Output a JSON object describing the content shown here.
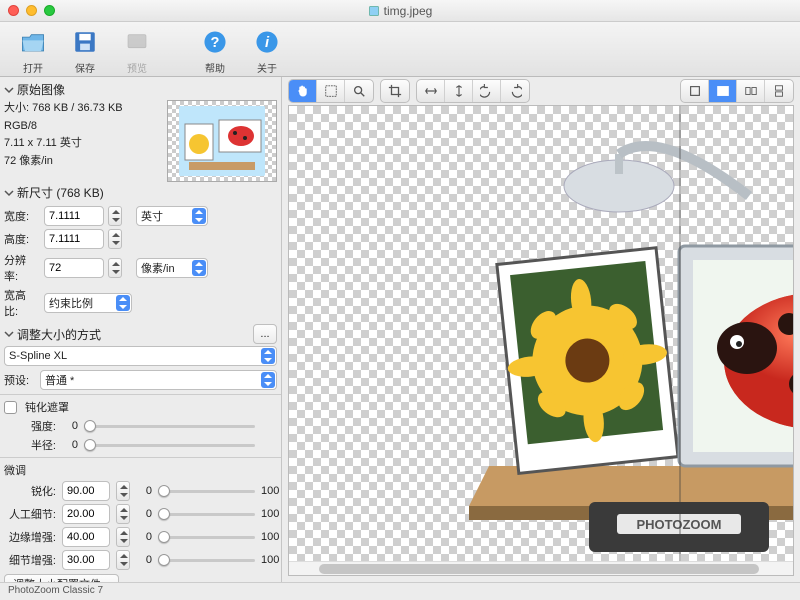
{
  "window": {
    "filename": "timg.jpeg"
  },
  "toolbar": {
    "open": "打开",
    "save": "保存",
    "preview": "预览",
    "help": "帮助",
    "about": "关于"
  },
  "orig": {
    "header": "原始图像",
    "size_line": "大小: 768 KB / 36.73 KB",
    "mode": "RGB/8",
    "dims": "7.11 x 7.11 英寸",
    "res": "72 像素/in"
  },
  "newsize": {
    "header": "新尺寸 (768 KB)",
    "width_label": "宽度:",
    "width_val": "7.1111",
    "height_label": "高度:",
    "height_val": "7.1111",
    "unit": "英寸",
    "res_label": "分辨率:",
    "res_val": "72",
    "res_unit": "像素/in",
    "aspect_label": "宽高比:",
    "aspect_val": "约束比例"
  },
  "resize": {
    "header": "调整大小的方式",
    "method": "S-Spline XL",
    "preset_label": "预设:",
    "preset_val": "普通 *",
    "unsharp_label": "钝化遮罩",
    "strength_label": "强度:",
    "strength_val": 0,
    "strength_max": "",
    "radius_label": "半径:",
    "radius_val": 0,
    "radius_max": "",
    "fine_header": "微调",
    "sharp_label": "锐化:",
    "sharp_val": "90.00",
    "sharp_cur": 0,
    "sharp_max": 100,
    "detail_label": "人工细节:",
    "detail_val": "20.00",
    "detail_cur": 0,
    "detail_max": 100,
    "edge_label": "边缘增强:",
    "edge_val": "40.00",
    "edge_cur": 0,
    "edge_max": 100,
    "fine_label": "细节增强:",
    "fine_val": "30.00",
    "fine_cur": 0,
    "fine_max": 100,
    "profile_btn": "调整大小配置文件...",
    "more": "..."
  },
  "status": {
    "app": "PhotoZoom Classic 7"
  },
  "colors": {
    "accent": "#4a8ef7"
  }
}
